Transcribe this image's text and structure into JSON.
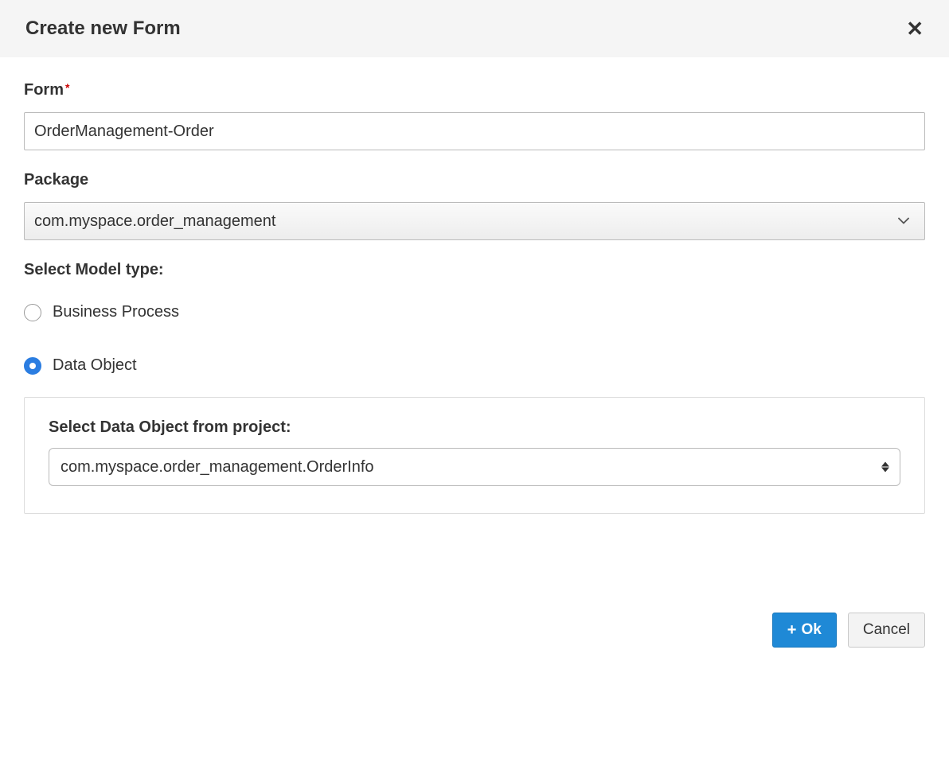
{
  "dialog": {
    "title": "Create new Form",
    "form_label": "Form",
    "form_value": "OrderManagement-Order",
    "package_label": "Package",
    "package_value": "com.myspace.order_management",
    "model_type_label": "Select Model type:",
    "model_type_options": {
      "business_process": "Business Process",
      "data_object": "Data Object"
    },
    "data_object_panel": {
      "label": "Select Data Object from project:",
      "value": "com.myspace.order_management.OrderInfo"
    },
    "buttons": {
      "ok": "Ok",
      "cancel": "Cancel"
    }
  }
}
